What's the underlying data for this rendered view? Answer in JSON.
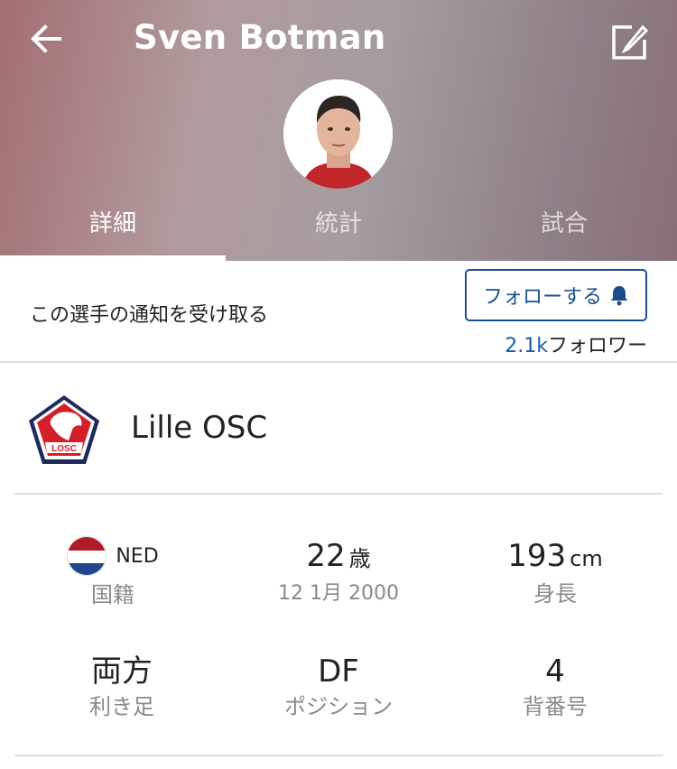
{
  "header": {
    "title": "Sven Botman",
    "icons": {
      "back": "arrow-left-icon",
      "edit": "edit-icon"
    }
  },
  "tabs": [
    {
      "label": "詳細",
      "active": true
    },
    {
      "label": "統計",
      "active": false
    },
    {
      "label": "試合",
      "active": false
    }
  ],
  "notify": {
    "text": "この選手の通知を受け取る",
    "follow_label": "フォローする",
    "follow_icon": "bell-icon",
    "follower_count": "2.1k",
    "follower_suffix": "フォロワー"
  },
  "team": {
    "name": "Lille OSC",
    "logo_text": "LOSC"
  },
  "stats": {
    "nationality": {
      "code": "NED",
      "label": "国籍"
    },
    "age": {
      "value": "22",
      "unit": "歳",
      "dob": "12 1月 2000"
    },
    "height": {
      "value": "193",
      "unit": "cm",
      "label": "身長"
    },
    "foot": {
      "value": "両方",
      "label": "利き足"
    },
    "position": {
      "value": "DF",
      "label": "ポジション"
    },
    "number": {
      "value": "4",
      "label": "背番号"
    }
  },
  "colors": {
    "accent": "#1b4f8a",
    "follower_count": "#1b5fa8",
    "muted": "#8a8a8a"
  }
}
